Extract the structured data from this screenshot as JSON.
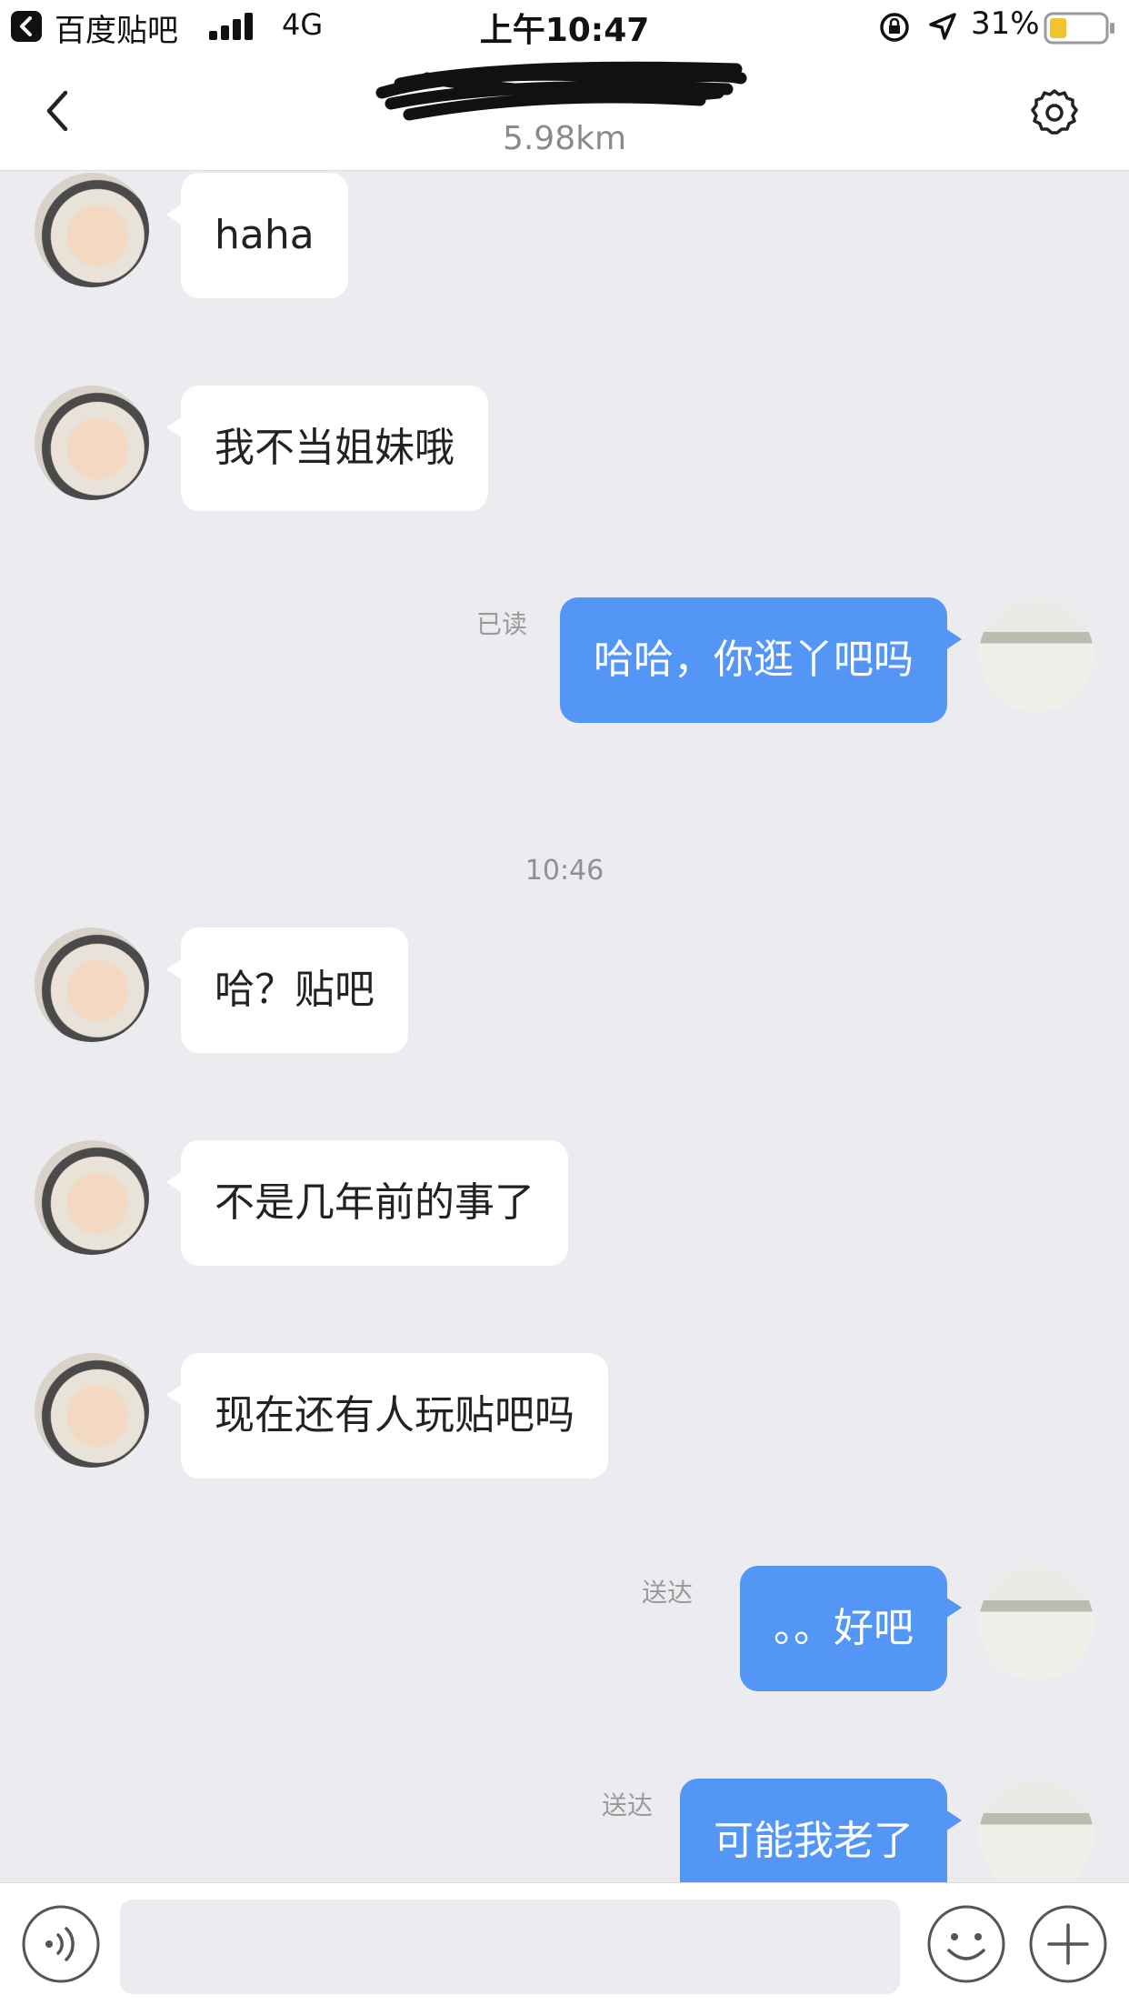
{
  "status_bar": {
    "back_app": "百度贴吧",
    "network": "4G",
    "time": "上午10:47",
    "battery": "31%"
  },
  "nav": {
    "distance": "5.98km",
    "icons": [
      "back-icon",
      "gear-icon"
    ]
  },
  "messages": [
    {
      "from": "them",
      "text": "haha"
    },
    {
      "from": "them",
      "text": "我不当姐妹哦"
    },
    {
      "from": "me",
      "text": "哈哈，你逛丫吧吗",
      "status": "已读"
    },
    {
      "from": "time",
      "text": "10:46"
    },
    {
      "from": "them",
      "text": "哈？贴吧"
    },
    {
      "from": "them",
      "text": "不是几年前的事了"
    },
    {
      "from": "them",
      "text": "现在还有人玩贴吧吗"
    },
    {
      "from": "me",
      "text": "。。好吧",
      "status": "送达"
    },
    {
      "from": "me",
      "text": "可能我老了",
      "status": "送达"
    }
  ],
  "input_bar": {
    "placeholder": "",
    "icons": [
      "voice-icon",
      "emoji-icon",
      "plus-icon"
    ]
  },
  "colors": {
    "outgoing_bubble": "#5496f6",
    "incoming_bubble": "#ffffff",
    "chat_background": "#ececf0"
  }
}
